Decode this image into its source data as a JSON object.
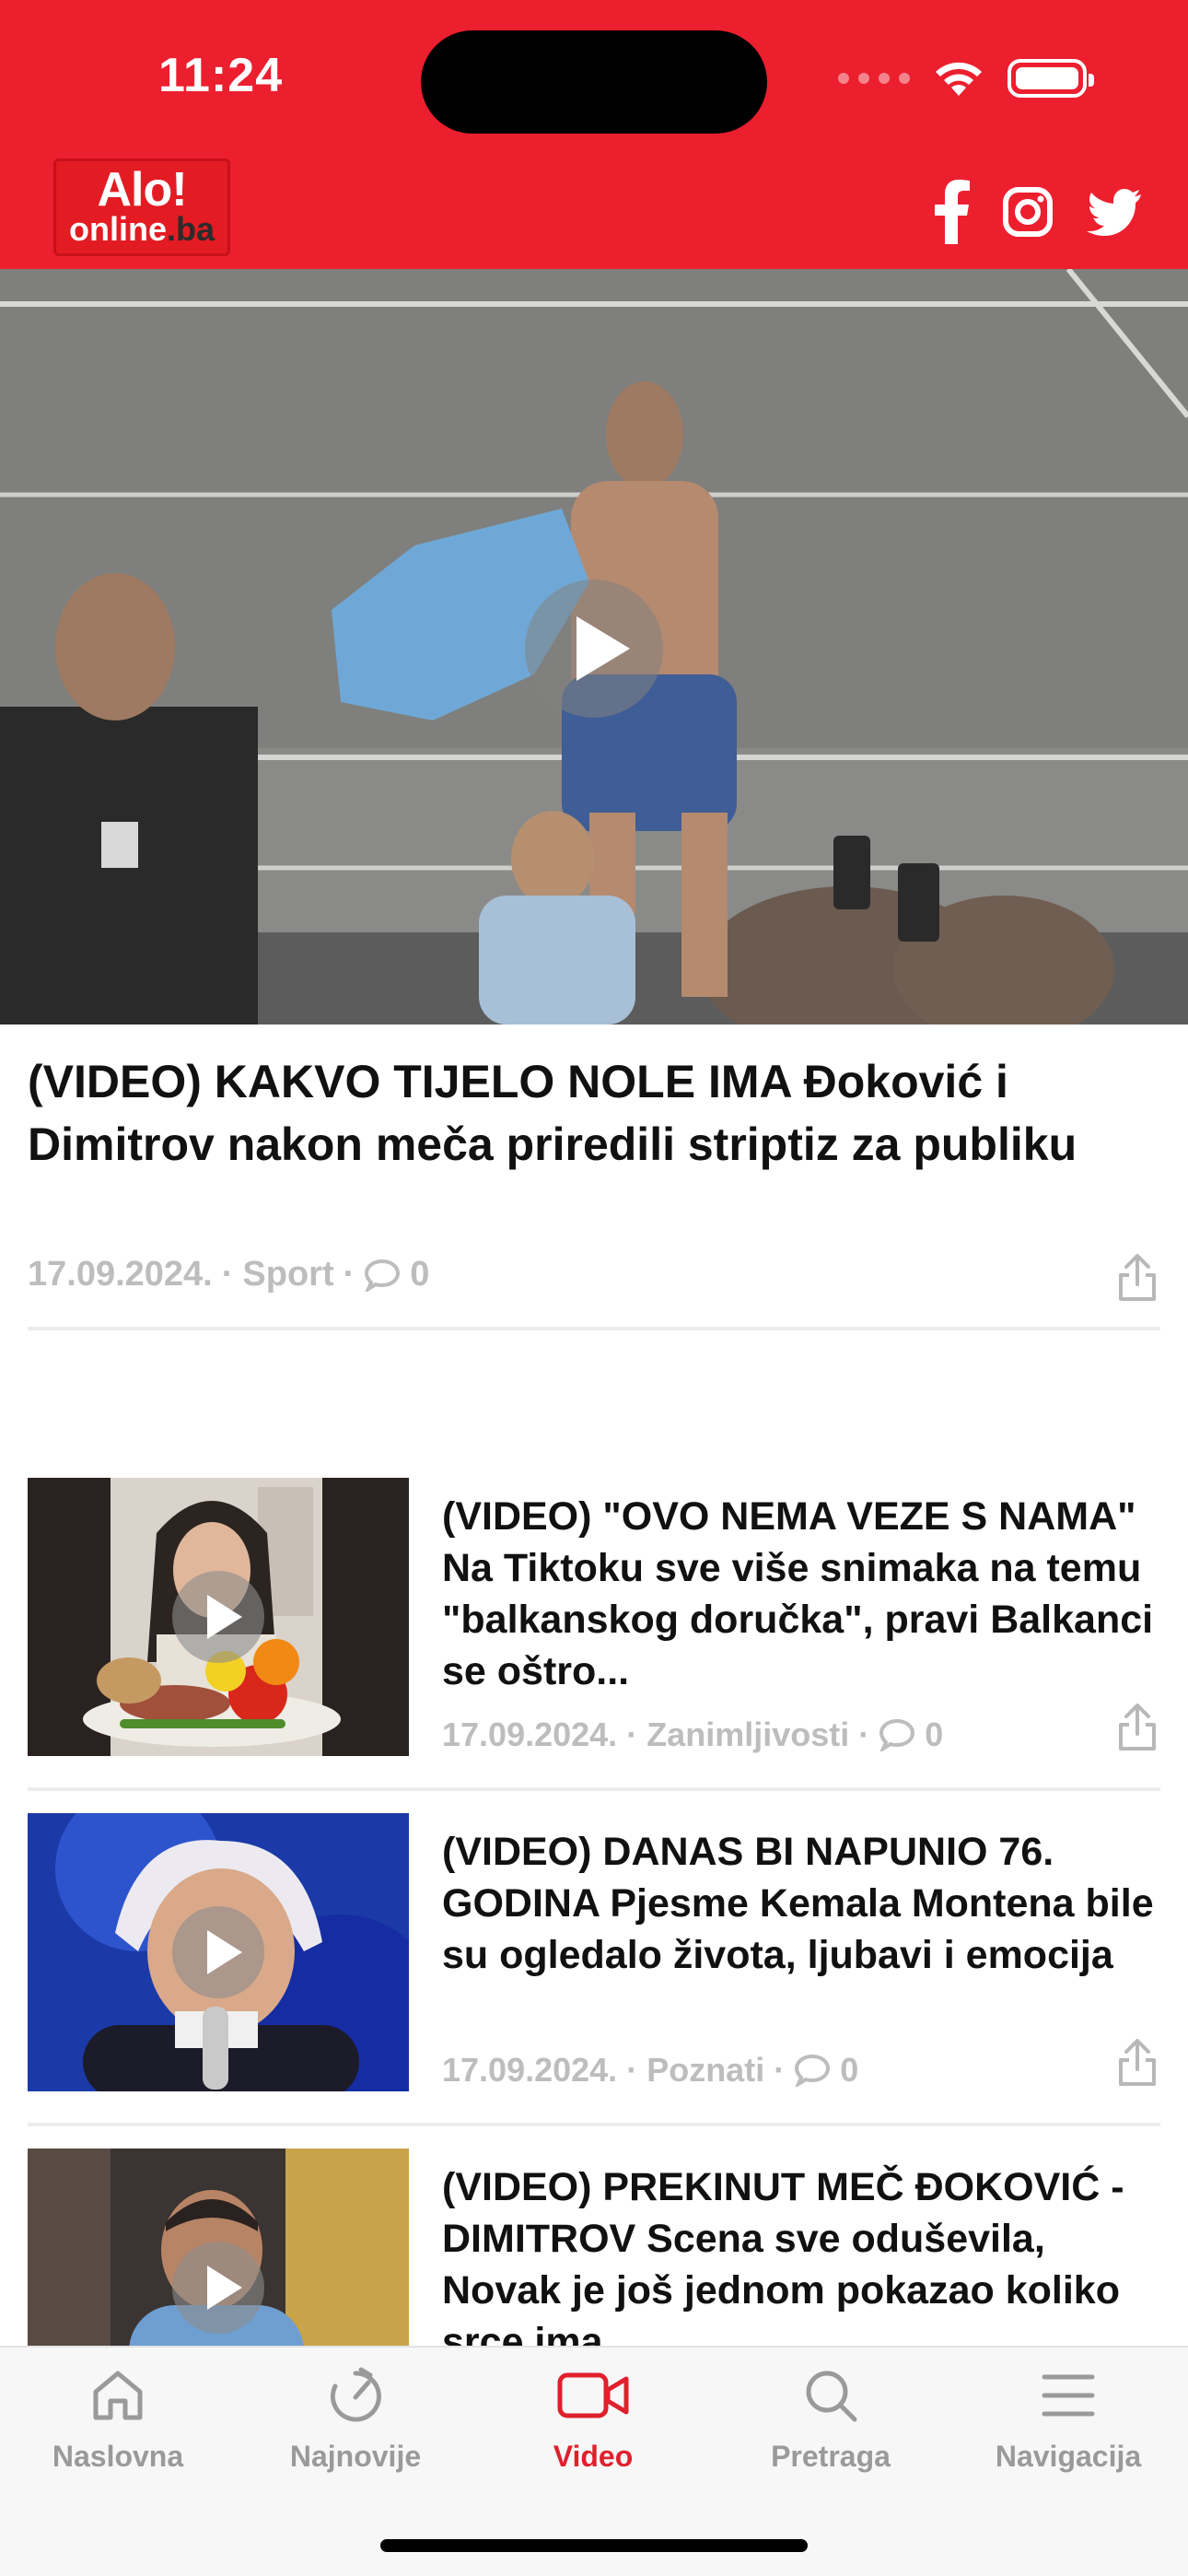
{
  "status_bar": {
    "time": "11:24"
  },
  "header": {
    "logo_top": "Alo!",
    "logo_domain": "online",
    "logo_tld": ".ba",
    "social": [
      "facebook-icon",
      "instagram-icon",
      "twitter-icon"
    ],
    "brand_color": "#ec1f2f"
  },
  "hero": {
    "title": "(VIDEO) KAKVO TIJELO NOLE IMA Đoković i Dimitrov nakon meča priredili striptiz za publiku",
    "date": "17.09.2024.",
    "category": "Sport",
    "comments": "0",
    "separator": "·"
  },
  "articles": [
    {
      "title": "(VIDEO) \"OVO NEMA VEZE S NAMA\" Na Tiktoku sve više snimaka na temu \"balkanskog doručka\", pravi Balkanci se oštro...",
      "date": "17.09.2024.",
      "category": "Zanimljivosti",
      "comments": "0"
    },
    {
      "title": "(VIDEO) DANAS BI NAPUNIO 76. GODINA Pjesme Kemala Montena bile su ogledalo života, ljubavi i emocija",
      "date": "17.09.2024.",
      "category": "Poznati",
      "comments": "0"
    },
    {
      "title": "(VIDEO) PREKINUT MEČ ĐOKOVIĆ - DIMITROV Scena sve oduševila, Novak je još jednom pokazao koliko srce ima",
      "date": "",
      "category": "",
      "comments": ""
    }
  ],
  "tabbar": {
    "tabs": [
      {
        "label": "Naslovna",
        "icon": "home-icon"
      },
      {
        "label": "Najnovije",
        "icon": "stopwatch-icon"
      },
      {
        "label": "Video",
        "icon": "video-camera-icon",
        "active": true
      },
      {
        "label": "Pretraga",
        "icon": "search-icon"
      },
      {
        "label": "Navigacija",
        "icon": "menu-icon"
      }
    ],
    "active_color": "#e0202d",
    "inactive_color": "#9a9a9a"
  }
}
